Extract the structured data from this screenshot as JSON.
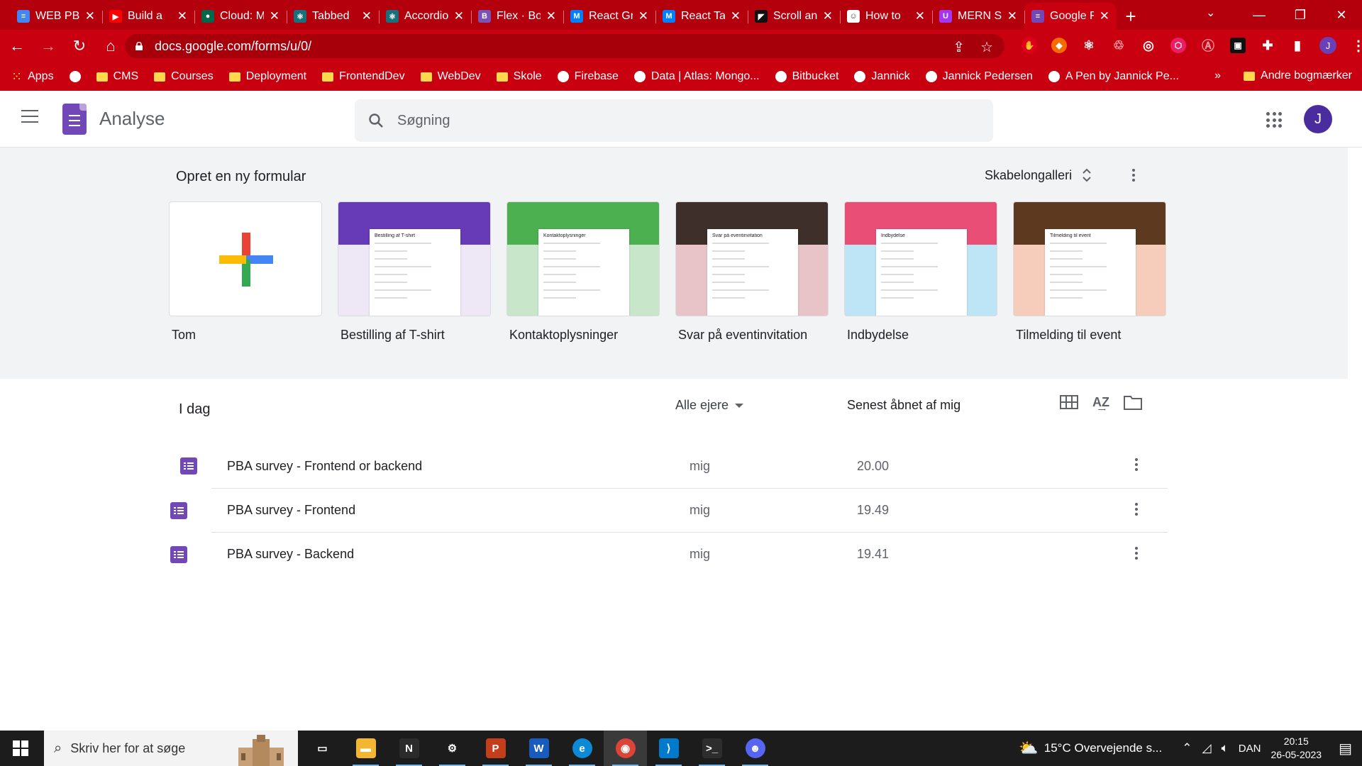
{
  "browser": {
    "tabs": [
      {
        "title": "WEB PBA",
        "icon": "google-docs-icon",
        "color": "#4285f4",
        "glyph": "≡"
      },
      {
        "title": "Build a",
        "icon": "youtube-icon",
        "color": "#ff0000",
        "glyph": "▶"
      },
      {
        "title": "Cloud: MongoDB",
        "icon": "mongodb-leaf-icon",
        "color": "#00684a",
        "glyph": "●"
      },
      {
        "title": "Tabbed",
        "icon": "react-bootstrap-icon",
        "color": "#1b6f7a",
        "glyph": "⚛"
      },
      {
        "title": "Accordion",
        "icon": "react-bootstrap-icon",
        "color": "#1b6f7a",
        "glyph": "⚛"
      },
      {
        "title": "Flex · Bootstrap",
        "icon": "bootstrap-icon",
        "color": "#7952b3",
        "glyph": "B"
      },
      {
        "title": "React Grid",
        "icon": "mui-icon",
        "color": "#007fff",
        "glyph": "M"
      },
      {
        "title": "React Tabs",
        "icon": "mui-icon",
        "color": "#007fff",
        "glyph": "M"
      },
      {
        "title": "Scroll and",
        "icon": "framer-icon",
        "color": "#111111",
        "glyph": "◤"
      },
      {
        "title": "How to",
        "icon": "ghost-icon",
        "color": "#ffffff",
        "glyph": "☺"
      },
      {
        "title": "MERN Stack",
        "icon": "udemy-icon",
        "color": "#a435f0",
        "glyph": "U"
      },
      {
        "title": "Google Forms",
        "icon": "google-forms-icon",
        "color": "#7248b9",
        "glyph": "≡"
      }
    ],
    "active_tab": 11,
    "new_tab": "+",
    "url": "docs.google.com/forms/u/0/",
    "bookmarks": [
      {
        "label": "Apps",
        "icon": "apps-grid-icon"
      },
      {
        "label": "",
        "icon": "globe-icon"
      },
      {
        "label": "CMS",
        "icon": "folder-icon"
      },
      {
        "label": "Courses",
        "icon": "folder-icon"
      },
      {
        "label": "Deployment",
        "icon": "folder-icon"
      },
      {
        "label": "FrontendDev",
        "icon": "folder-icon"
      },
      {
        "label": "WebDev",
        "icon": "folder-icon"
      },
      {
        "label": "Skole",
        "icon": "folder-icon"
      },
      {
        "label": "Firebase",
        "icon": "firebase-icon"
      },
      {
        "label": "Data | Atlas: Mongo...",
        "icon": "mongodb-leaf-icon"
      },
      {
        "label": "Bitbucket",
        "icon": "bitbucket-icon"
      },
      {
        "label": "Jannick",
        "icon": "github-icon"
      },
      {
        "label": "Jannick Pedersen",
        "icon": "linkedin-icon"
      },
      {
        "label": "A Pen by Jannick Pe...",
        "icon": "codepen-icon"
      }
    ],
    "bookmarks_overflow": "»",
    "other_bookmarks": "Andre bogmærker",
    "profile_initial": "J"
  },
  "app": {
    "title": "Analyse",
    "search_placeholder": "Søgning",
    "avatar_initial": "J"
  },
  "gallery": {
    "title": "Opret en ny formular",
    "switch_label": "Skabelongalleri",
    "templates": [
      {
        "label": "Tom",
        "banner": "",
        "paper_title": ""
      },
      {
        "label": "Bestilling af T-shirt",
        "banner": "#673ab7",
        "bg": "#ede7f6",
        "paper_title": "Bestilling af T-shirt"
      },
      {
        "label": "Kontaktoplysninger",
        "banner": "#4caf50",
        "bg": "#c8e6c9",
        "paper_title": "Kontaktoplysninger"
      },
      {
        "label": "Svar på eventinvitation",
        "banner": "#3e2f2a",
        "bg": "#e8c4c8",
        "paper_title": "Svar på eventinvitation"
      },
      {
        "label": "Indbydelse",
        "banner": "#e94e77",
        "bg": "#bde5f6",
        "paper_title": "Indbydelse"
      },
      {
        "label": "Tilmelding til event",
        "banner": "#5d3a1f",
        "bg": "#f6cdbb",
        "paper_title": "Tilmelding til event"
      }
    ]
  },
  "recent": {
    "section_title": "I dag",
    "owner_filter": "Alle ejere",
    "sort_label": "Senest åbnet af mig",
    "rows": [
      {
        "name": "PBA survey - Frontend or backend",
        "owner": "mig",
        "opened": "20.00"
      },
      {
        "name": "PBA survey - Frontend",
        "owner": "mig",
        "opened": "19.49"
      },
      {
        "name": "PBA survey - Backend",
        "owner": "mig",
        "opened": "19.41"
      }
    ]
  },
  "taskbar": {
    "search_placeholder": "Skriv her for at søge",
    "weather": "15°C  Overvejende s...",
    "language": "DAN",
    "time": "20:15",
    "date": "26-05-2023",
    "apps": [
      {
        "name": "task-view",
        "color": "#1c1c1c",
        "glyph": "▭"
      },
      {
        "name": "file-explorer",
        "color": "#f2b632",
        "glyph": "▬"
      },
      {
        "name": "notion",
        "color": "#2b2b2b",
        "glyph": "N"
      },
      {
        "name": "steam",
        "color": "#1c1c1c",
        "glyph": "⚙"
      },
      {
        "name": "powerpoint",
        "color": "#c43e1c",
        "glyph": "P"
      },
      {
        "name": "word",
        "color": "#185abd",
        "glyph": "W"
      },
      {
        "name": "edge",
        "color": "#0c8ad6",
        "glyph": "e"
      },
      {
        "name": "chrome",
        "color": "#db4437",
        "glyph": "◉"
      },
      {
        "name": "vscode",
        "color": "#007acc",
        "glyph": "⟩"
      },
      {
        "name": "terminal",
        "color": "#2d2d2d",
        "glyph": ">_"
      },
      {
        "name": "discord",
        "color": "#5865f2",
        "glyph": "☻"
      }
    ],
    "active_app": 7
  }
}
